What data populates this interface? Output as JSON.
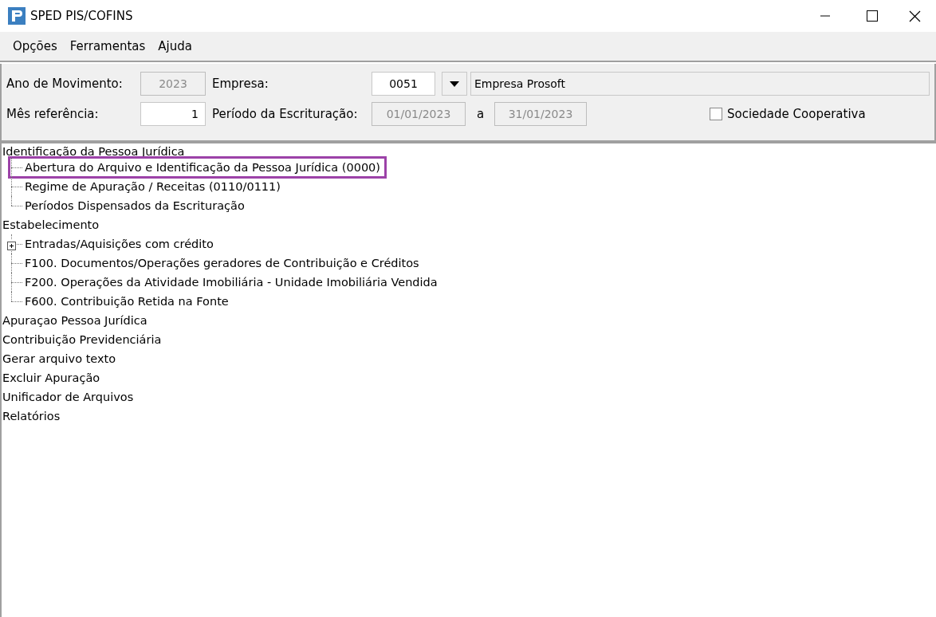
{
  "window": {
    "title": "SPED PIS/COFINS"
  },
  "menu": [
    "Opções",
    "Ferramentas",
    "Ajuda"
  ],
  "form": {
    "ano_movimento": {
      "label": "Ano de Movimento:",
      "value": "2023",
      "disabled": true
    },
    "empresa": {
      "label": "Empresa:",
      "code": "0051",
      "name": "Empresa Prosoft"
    },
    "mes_referencia": {
      "label": "Mês referência:",
      "value": "1",
      "disabled": false
    },
    "periodo": {
      "label": "Período da Escrituração:",
      "start": "01/01/2023",
      "separator": "a",
      "end": "31/01/2023",
      "disabled": true
    },
    "sociedade_cooperativa": {
      "label": "Sociedade Cooperativa",
      "checked": false
    }
  },
  "tree": [
    {
      "label": "Identificação da Pessoa Jurídica",
      "children": [
        {
          "label": "Abertura do Arquivo e Identificação da Pessoa Jurídica (0000)",
          "highlighted": true
        },
        {
          "label": "Regime de Apuração / Receitas (0110/0111)",
          "highlighted": false
        },
        {
          "label": "Períodos Dispensados da Escrituração",
          "highlighted": false
        }
      ]
    },
    {
      "label": "Estabelecimento",
      "children": [
        {
          "label": "Entradas/Aquisições com crédito",
          "highlighted": false,
          "expanded": false
        },
        {
          "label": "F100. Documentos/Operações geradores de Contribuição e Créditos",
          "highlighted": false
        },
        {
          "label": "F200. Operações da Atividade Imobiliária - Unidade Imobiliária Vendida",
          "highlighted": false
        },
        {
          "label": "F600. Contribuição Retida na Fonte",
          "highlighted": false
        }
      ]
    },
    {
      "label": "Apuraçao Pessoa Jurídica"
    },
    {
      "label": "Contribuição Previdenciária"
    },
    {
      "label": "Gerar arquivo texto"
    },
    {
      "label": "Excluir Apuração"
    },
    {
      "label": "Unificador de Arquivos"
    },
    {
      "label": "Relatórios"
    }
  ]
}
